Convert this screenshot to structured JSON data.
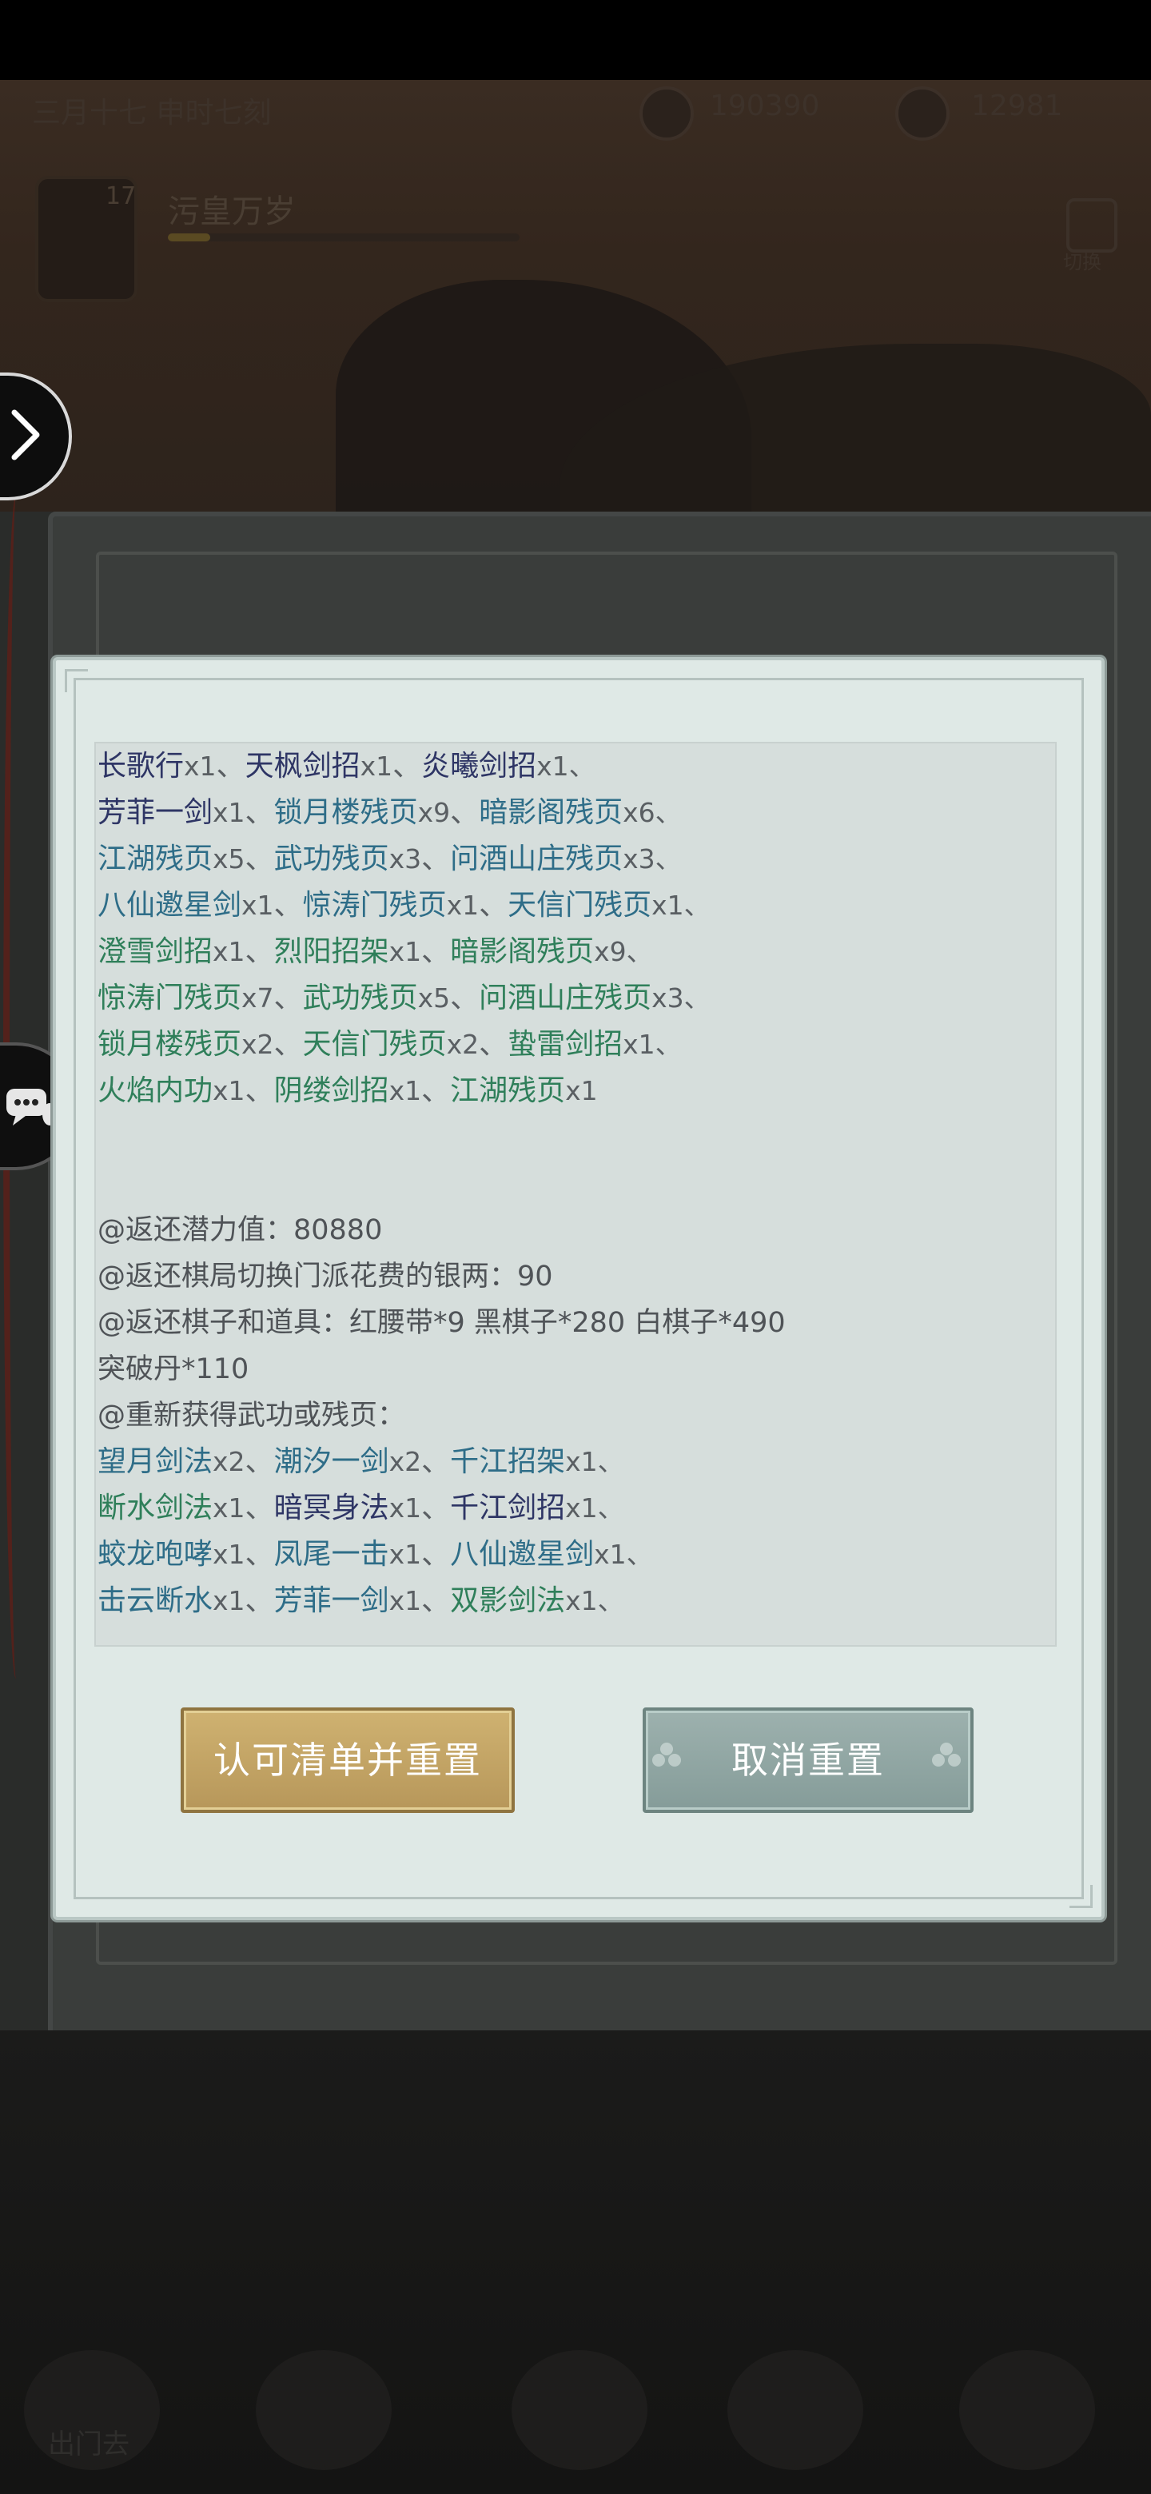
{
  "status_bar": {
    "date_text": "三月十七  申时七刻",
    "silver_amount": "190390",
    "jade_amount": "12981"
  },
  "player": {
    "level": "17",
    "name": "污皇万岁",
    "xp_fraction": 0.12
  },
  "header": {
    "exit_label": "切换"
  },
  "bottom_nav": {
    "first_label": "出门去"
  },
  "dialog": {
    "lines": [
      [
        [
          "长歌行",
          "purple",
          "x1"
        ],
        [
          "天枫剑招",
          "purple",
          "x1"
        ],
        [
          "炎曦剑招",
          "purple",
          "x1、"
        ]
      ],
      [
        [
          "芳菲一剑",
          "purple",
          "x1"
        ],
        [
          "锁月楼残页",
          "blue",
          "x9"
        ],
        [
          "暗影阁残页",
          "blue",
          "x6、"
        ]
      ],
      [
        [
          "江湖残页",
          "blue",
          "x5"
        ],
        [
          "武功残页",
          "blue",
          "x3"
        ],
        [
          "问酒山庄残页",
          "blue",
          "x3、"
        ]
      ],
      [
        [
          "八仙邀星剑",
          "blue",
          "x1"
        ],
        [
          "惊涛门残页",
          "blue",
          "x1"
        ],
        [
          "天信门残页",
          "blue",
          "x1、"
        ]
      ],
      [
        [
          "澄雪剑招",
          "green",
          "x1"
        ],
        [
          "烈阳招架",
          "green",
          "x1"
        ],
        [
          "暗影阁残页",
          "green",
          "x9、"
        ]
      ],
      [
        [
          "惊涛门残页",
          "green",
          "x7"
        ],
        [
          "武功残页",
          "green",
          "x5"
        ],
        [
          "问酒山庄残页",
          "green",
          "x3、"
        ]
      ],
      [
        [
          "锁月楼残页",
          "green",
          "x2"
        ],
        [
          "天信门残页",
          "green",
          "x2"
        ],
        [
          "蛰雷剑招",
          "green",
          "x1、"
        ]
      ],
      [
        [
          "火焰内功",
          "green",
          "x1"
        ],
        [
          "阴缕剑招",
          "green",
          "x1"
        ],
        [
          "江湖残页",
          "green",
          "x1"
        ]
      ]
    ],
    "refund_potential": "@返还潜力值：80880",
    "refund_silver": "@返还棋局切换门派花费的银两：90",
    "refund_items": "@返还棋子和道具：红腰带*9  黑棋子*280  白棋子*490",
    "refund_items_cont": "突破丹*110",
    "regain_header": "@重新获得武功或残页：",
    "regain_lines": [
      [
        [
          "望月剑法",
          "blue",
          "x2"
        ],
        [
          "潮汐一剑",
          "blue",
          "x2"
        ],
        [
          "千江招架",
          "blue",
          "x1、"
        ]
      ],
      [
        [
          "断水剑法",
          "green",
          "x1"
        ],
        [
          "暗冥身法",
          "purple",
          "x1"
        ],
        [
          "千江剑招",
          "purple",
          "x1、"
        ]
      ],
      [
        [
          "蛟龙咆哮",
          "blue",
          "x1"
        ],
        [
          "凤尾一击",
          "blue",
          "x1"
        ],
        [
          "八仙邀星剑",
          "blue",
          "x1、"
        ]
      ],
      [
        [
          "击云断水",
          "blue",
          "x1"
        ],
        [
          "芳菲一剑",
          "blue",
          "x1"
        ],
        [
          "双影剑法",
          "green",
          "x1、"
        ]
      ]
    ],
    "confirm_label": "认可清单并重置",
    "cancel_label": "取消重置"
  },
  "colors": {
    "purple": "#2e3565",
    "blue": "#2e6d88",
    "green": "#2f7f5a",
    "confirm_bg": "#c4a664",
    "cancel_bg": "#92a7a4"
  }
}
